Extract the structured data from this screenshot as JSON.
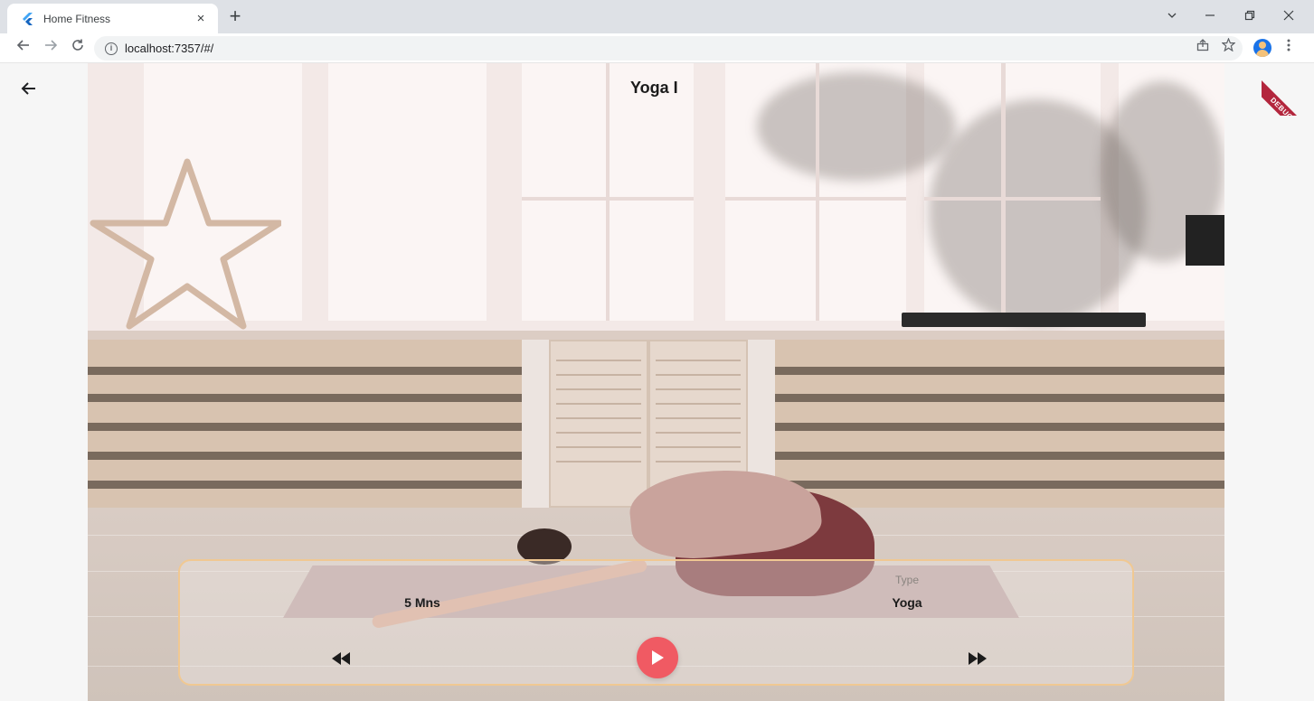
{
  "browser": {
    "tab_title": "Home Fitness",
    "tab_close": "×",
    "new_tab": "+",
    "url": "localhost:7357/#/",
    "info_glyph": "i"
  },
  "app": {
    "title": "Yoga I",
    "duration_value": "5 Mns",
    "type_label": "Type",
    "type_value": "Yoga",
    "debug_banner": "DEBUG"
  },
  "colors": {
    "play_button": "#f05a63",
    "panel_border": "#f0c892",
    "debug_ribbon": "#b3263d"
  },
  "icons": {
    "back": "arrow-left-icon",
    "rewind": "rewind-icon",
    "play": "play-icon",
    "fast_forward": "fast-forward-icon"
  }
}
